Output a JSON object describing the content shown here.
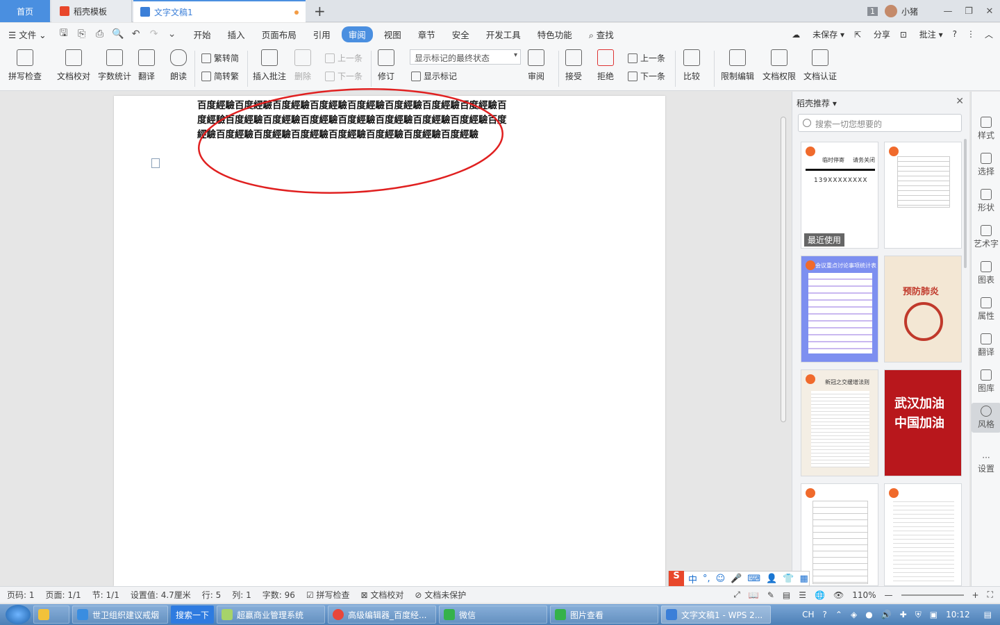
{
  "tabs": {
    "home": "首页",
    "template": "稻壳模板",
    "doc": "文字文稿1"
  },
  "window": {
    "badge": "1",
    "user": "小猪"
  },
  "menu": {
    "file": "文件",
    "items": [
      "开始",
      "插入",
      "页面布局",
      "引用",
      "审阅",
      "视图",
      "章节",
      "安全",
      "开发工具",
      "特色功能"
    ],
    "find": "查找",
    "unsaved": "未保存",
    "share": "分享",
    "comment": "批注"
  },
  "ribbon": {
    "spellcheck": "拼写检查",
    "proofread": "文档校对",
    "wordcount": "字数统计",
    "translate": "翻译",
    "read": "朗读",
    "to_traditional": "繁转简",
    "to_simplified": "简转繁",
    "insert_comment": "插入批注",
    "delete": "删除",
    "prev": "上一条",
    "next": "下一条",
    "revise": "修订",
    "markup_state": "显示标记的最终状态",
    "show_markup": "显示标记",
    "review": "审阅",
    "accept": "接受",
    "reject": "拒绝",
    "prev2": "上一条",
    "next2": "下一条",
    "compare": "比较",
    "restrict": "限制编辑",
    "rights": "文档权限",
    "certify": "文档认证"
  },
  "document": {
    "text": "百度經驗百度經驗百度經驗百度經驗百度經驗百度經驗百度經驗百度經驗百度經驗百度經驗百度經驗百度經驗百度經驗百度經驗百度經驗百度經驗百度經驗百度經驗百度經驗百度經驗百度經驗百度經驗百度經驗百度經驗"
  },
  "panel": {
    "title": "稻壳推荐",
    "search_placeholder": "搜索一切您想要的",
    "recent_label": "最近使用",
    "card1_text1": "临时停寄",
    "card1_text2": "请务关闭",
    "card1_phone": "139XXXXXXXX",
    "card3_title": "会议重点讨论事项统计表",
    "card4_title": "预防肺炎",
    "card5_title": "新冠之交缓增法则",
    "card6_text1": "武汉加油",
    "card6_text2": "中国加油"
  },
  "tools": {
    "items": [
      "样式",
      "选择",
      "形状",
      "艺术字",
      "图表",
      "属性",
      "翻译",
      "图库",
      "风格",
      "设置"
    ]
  },
  "status": {
    "page_num": "页码: 1",
    "pages": "页面: 1/1",
    "section": "节: 1/1",
    "setting": "设置值: 4.7厘米",
    "row": "行: 5",
    "col": "列: 1",
    "words": "字数: 96",
    "spell": "拼写检查",
    "proof": "文档校对",
    "protect": "文档未保护",
    "zoom": "110%"
  },
  "ime": {
    "lang": "中"
  },
  "taskbar": {
    "items": [
      "世卫组织建议戒烟",
      "搜索一下",
      "超赢商业管理系统",
      "高级编辑器_百度经...",
      "微信",
      "图片查看",
      "文字文稿1 - WPS 2..."
    ],
    "lang": "CH",
    "time": "10:12"
  },
  "colors": {
    "accent": "#4a8fe0",
    "ellipse": "#e02020",
    "wps_red": "#f06a2c"
  }
}
